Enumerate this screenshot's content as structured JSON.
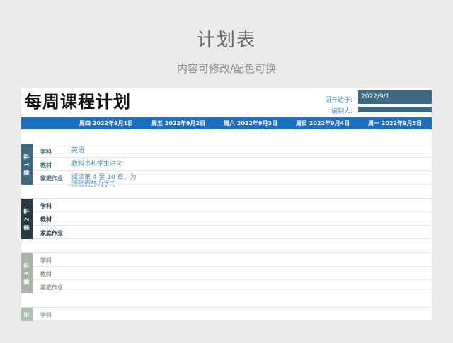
{
  "header": {
    "title": "计划表",
    "subtitle": "内容可修改/配色可换"
  },
  "sheet": {
    "title": "每周课程计划",
    "start_label": "周开始于:",
    "start_value": "2022/9/1",
    "editor_label": "编制人:",
    "editor_value": "",
    "days": [
      "周四  2022年9月1日",
      "周五  2022年9月2日",
      "周六  2022年9月3日",
      "周日  2022年9月4日",
      "周一  2022年9月5日"
    ]
  },
  "sections": [
    {
      "tab": "第 1 节",
      "color": "#3d6a82",
      "label_color": "#3d6a82",
      "rows": [
        {
          "label": "学科",
          "value": "英语"
        },
        {
          "label": "教材",
          "value": "教科书和学生讲义"
        },
        {
          "label": "家庭作业",
          "value": "阅读第 4 至 10 章，为\n测验而努力学习"
        }
      ]
    },
    {
      "tab": "第 2 节",
      "color": "#243a44",
      "label_color": "#243a44",
      "rows": [
        {
          "label": "学科",
          "value": ""
        },
        {
          "label": "教材",
          "value": ""
        },
        {
          "label": "家庭作业",
          "value": ""
        }
      ]
    },
    {
      "tab": "第 3 节",
      "color": "#a9b5a4",
      "label_color": "#8a9a84",
      "rows": [
        {
          "label": "学科",
          "value": ""
        },
        {
          "label": "教材",
          "value": ""
        },
        {
          "label": "家庭作业",
          "value": ""
        }
      ]
    },
    {
      "tab": "节",
      "color": "#a9c3b3",
      "label_color": "#8aa894",
      "rows": [
        {
          "label": "学科",
          "value": ""
        }
      ]
    }
  ]
}
